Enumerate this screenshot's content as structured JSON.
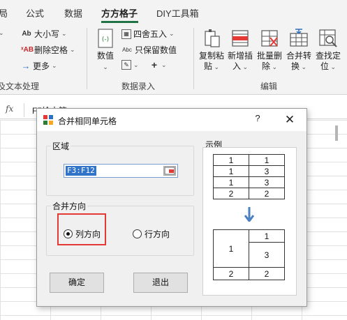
{
  "ribbon": {
    "tabs": [
      {
        "label": "局"
      },
      {
        "label": "公式"
      },
      {
        "label": "数据"
      },
      {
        "label": "方方格子",
        "active": true
      },
      {
        "label": "DIY工具箱"
      }
    ],
    "text_group": {
      "items": [
        {
          "label": "大小写",
          "icon": "letter-case-icon"
        },
        {
          "label": "删除空格",
          "icon": "delete-space-icon"
        },
        {
          "label": "更多",
          "icon": "arrow-right-icon"
        }
      ],
      "label": "及文本处理"
    },
    "number_group": {
      "big_button": {
        "label": "数值",
        "icon": "numeric-icon"
      },
      "items": [
        {
          "label": "四舍五入",
          "icon": "round-icon"
        },
        {
          "label": "只保留数值",
          "icon": "keep-number-icon"
        },
        {
          "label": "",
          "icon": "edit-icon"
        },
        {
          "label": "",
          "icon": "plus-icon"
        }
      ],
      "label": "数据录入"
    },
    "edit_group": {
      "buttons": [
        {
          "line1": "复制粘",
          "line2": "贴",
          "icon": "copy-paste-icon"
        },
        {
          "line1": "新增插",
          "line2": "入",
          "icon": "insert-icon"
        },
        {
          "line1": "批量删",
          "line2": "除",
          "icon": "batch-delete-icon"
        },
        {
          "line1": "合并转",
          "line2": "换",
          "icon": "merge-convert-icon"
        },
        {
          "line1": "查找定",
          "line2": "位",
          "icon": "find-locate-icon"
        }
      ],
      "label": "编辑"
    }
  },
  "formula_bar": {
    "fx": "fx",
    "content": "F5绘水管"
  },
  "dialog": {
    "title": "合并相同单元格",
    "help": "?",
    "close": "✕",
    "region": {
      "legend": "区域",
      "value": "F3:F12"
    },
    "direction": {
      "legend": "合并方向",
      "options": [
        "列方向",
        "行方向"
      ],
      "selected": "列方向"
    },
    "buttons": {
      "ok": "确定",
      "exit": "退出"
    },
    "example": {
      "legend": "示例",
      "before": [
        [
          "1",
          "1"
        ],
        [
          "1",
          "3"
        ],
        [
          "1",
          "3"
        ],
        [
          "2",
          "2"
        ]
      ],
      "after": {
        "merged_left": "1",
        "right": [
          "1",
          "3"
        ],
        "last": [
          "2",
          "2"
        ]
      },
      "arrow_color": "#4a7fc1"
    }
  },
  "colors": {
    "accent": "#217346",
    "highlight": "#e53935",
    "selection": "#3174c9"
  }
}
